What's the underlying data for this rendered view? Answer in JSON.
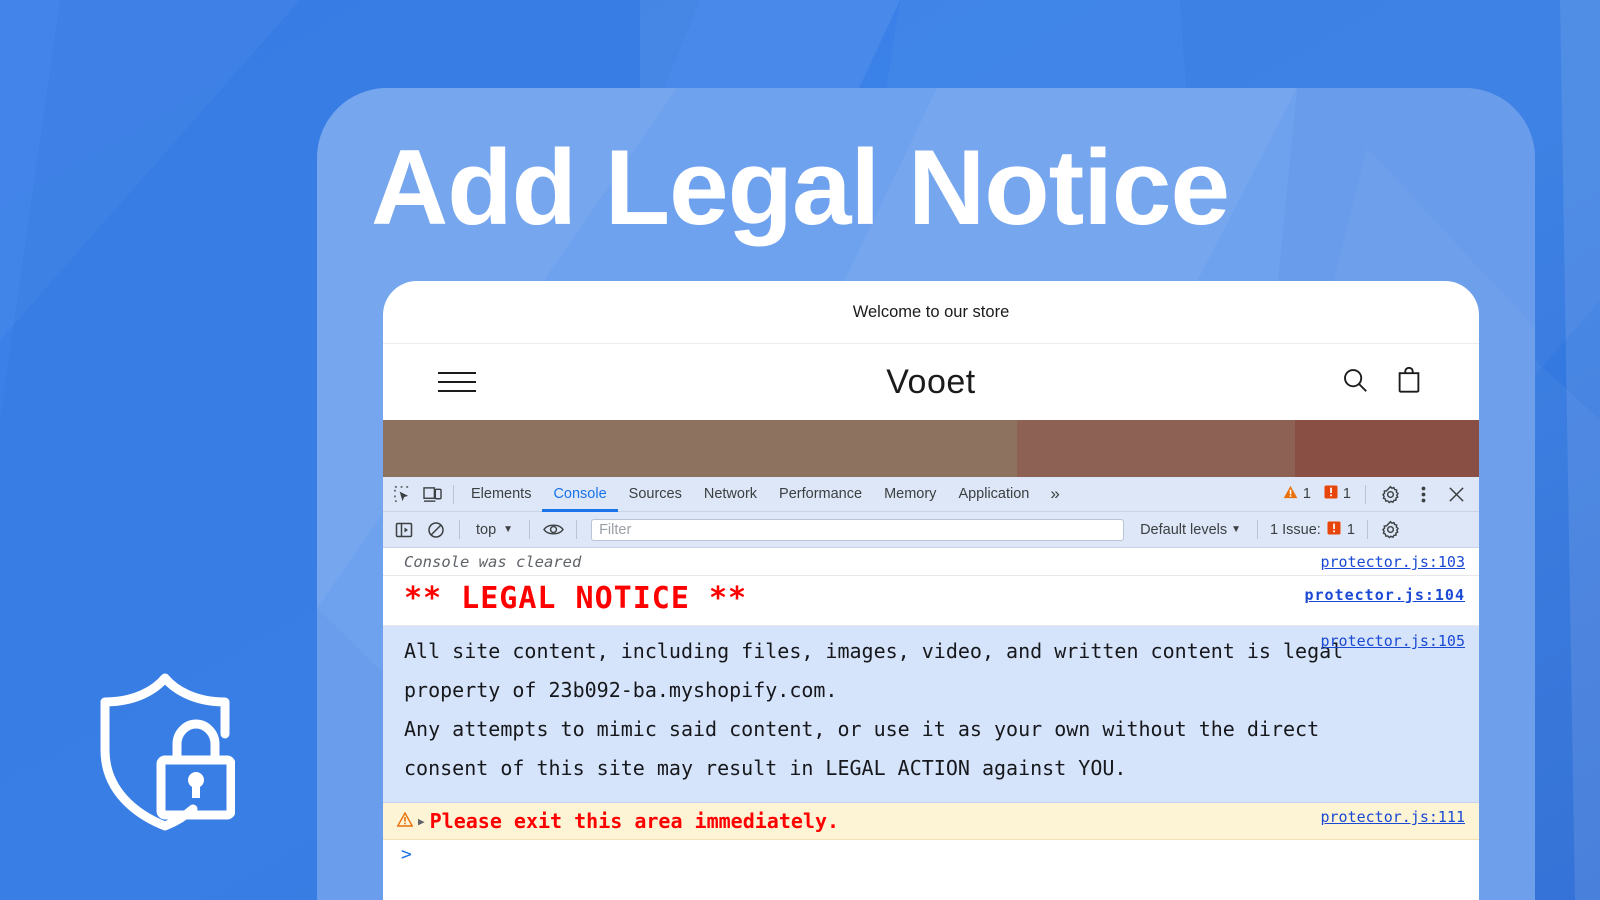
{
  "headline": "Add Legal Notice",
  "colors": {
    "bg_blue": "#3b82e8",
    "panel_blue": "#6fa2ee",
    "accent_link": "#1a49d4",
    "error_red": "#ff0000",
    "tab_active": "#1a73e8",
    "warn_bg": "#fdf4d5",
    "legal_bg": "#d6e4fb",
    "hero_brown_1": "#8e7260",
    "hero_brown_2": "#8d6154",
    "hero_brown_3": "#8a4f44"
  },
  "badge": {
    "icon": "shield-lock-icon"
  },
  "storefront": {
    "announcement": "Welcome to our store",
    "store_name": "Vooet",
    "menu_icon": "hamburger-menu-icon",
    "search_icon": "search-icon",
    "cart_icon": "shopping-bag-icon",
    "hero_segments": [
      "#8e7260",
      "#8d6154",
      "#8a4f44"
    ]
  },
  "devtools": {
    "inspect_icon": "inspect-element-icon",
    "device_icon": "device-toolbar-icon",
    "tabs": [
      {
        "label": "Elements",
        "active": false
      },
      {
        "label": "Console",
        "active": true
      },
      {
        "label": "Sources",
        "active": false
      },
      {
        "label": "Network",
        "active": false
      },
      {
        "label": "Performance",
        "active": false
      },
      {
        "label": "Memory",
        "active": false
      },
      {
        "label": "Application",
        "active": false
      }
    ],
    "more_tabs_icon": "chevron-double-right-icon",
    "warning_icon": "warning-triangle-icon",
    "warning_count": "1",
    "error_icon": "error-square-icon",
    "error_count": "1",
    "settings_icon": "gear-icon",
    "kebab_icon": "more-vertical-icon",
    "close_icon": "close-icon",
    "toolbar": {
      "sidebar_icon": "console-sidebar-icon",
      "clear_icon": "clear-console-icon",
      "context_value": "top",
      "context_caret": "▼",
      "eye_icon": "live-expression-icon",
      "filter_placeholder": "Filter",
      "filter_value": "",
      "levels_label": "Default levels",
      "levels_caret": "▼",
      "issues_label": "1 Issue:",
      "issues_icon": "error-square-icon",
      "issues_count": "1",
      "settings_icon": "gear-icon"
    }
  },
  "console": {
    "rows": [
      {
        "kind": "cleared",
        "text": "Console was cleared",
        "source": "protector.js:103"
      },
      {
        "kind": "title",
        "text": "** LEGAL NOTICE **",
        "source": "protector.js:104"
      },
      {
        "kind": "legal",
        "lines": [
          "All site content, including files, images, video, and written content is legal",
          "property of 23b092-ba.myshopify.com.",
          "Any attempts to mimic said content, or use it as your own without the direct",
          "consent of this site may result in LEGAL ACTION against YOU."
        ],
        "source": "protector.js:105"
      },
      {
        "kind": "warning",
        "icon": "warning-triangle-icon",
        "disclosure": "▶",
        "text": "Please exit this area immediately.",
        "source": "protector.js:111"
      }
    ],
    "prompt": ">"
  }
}
